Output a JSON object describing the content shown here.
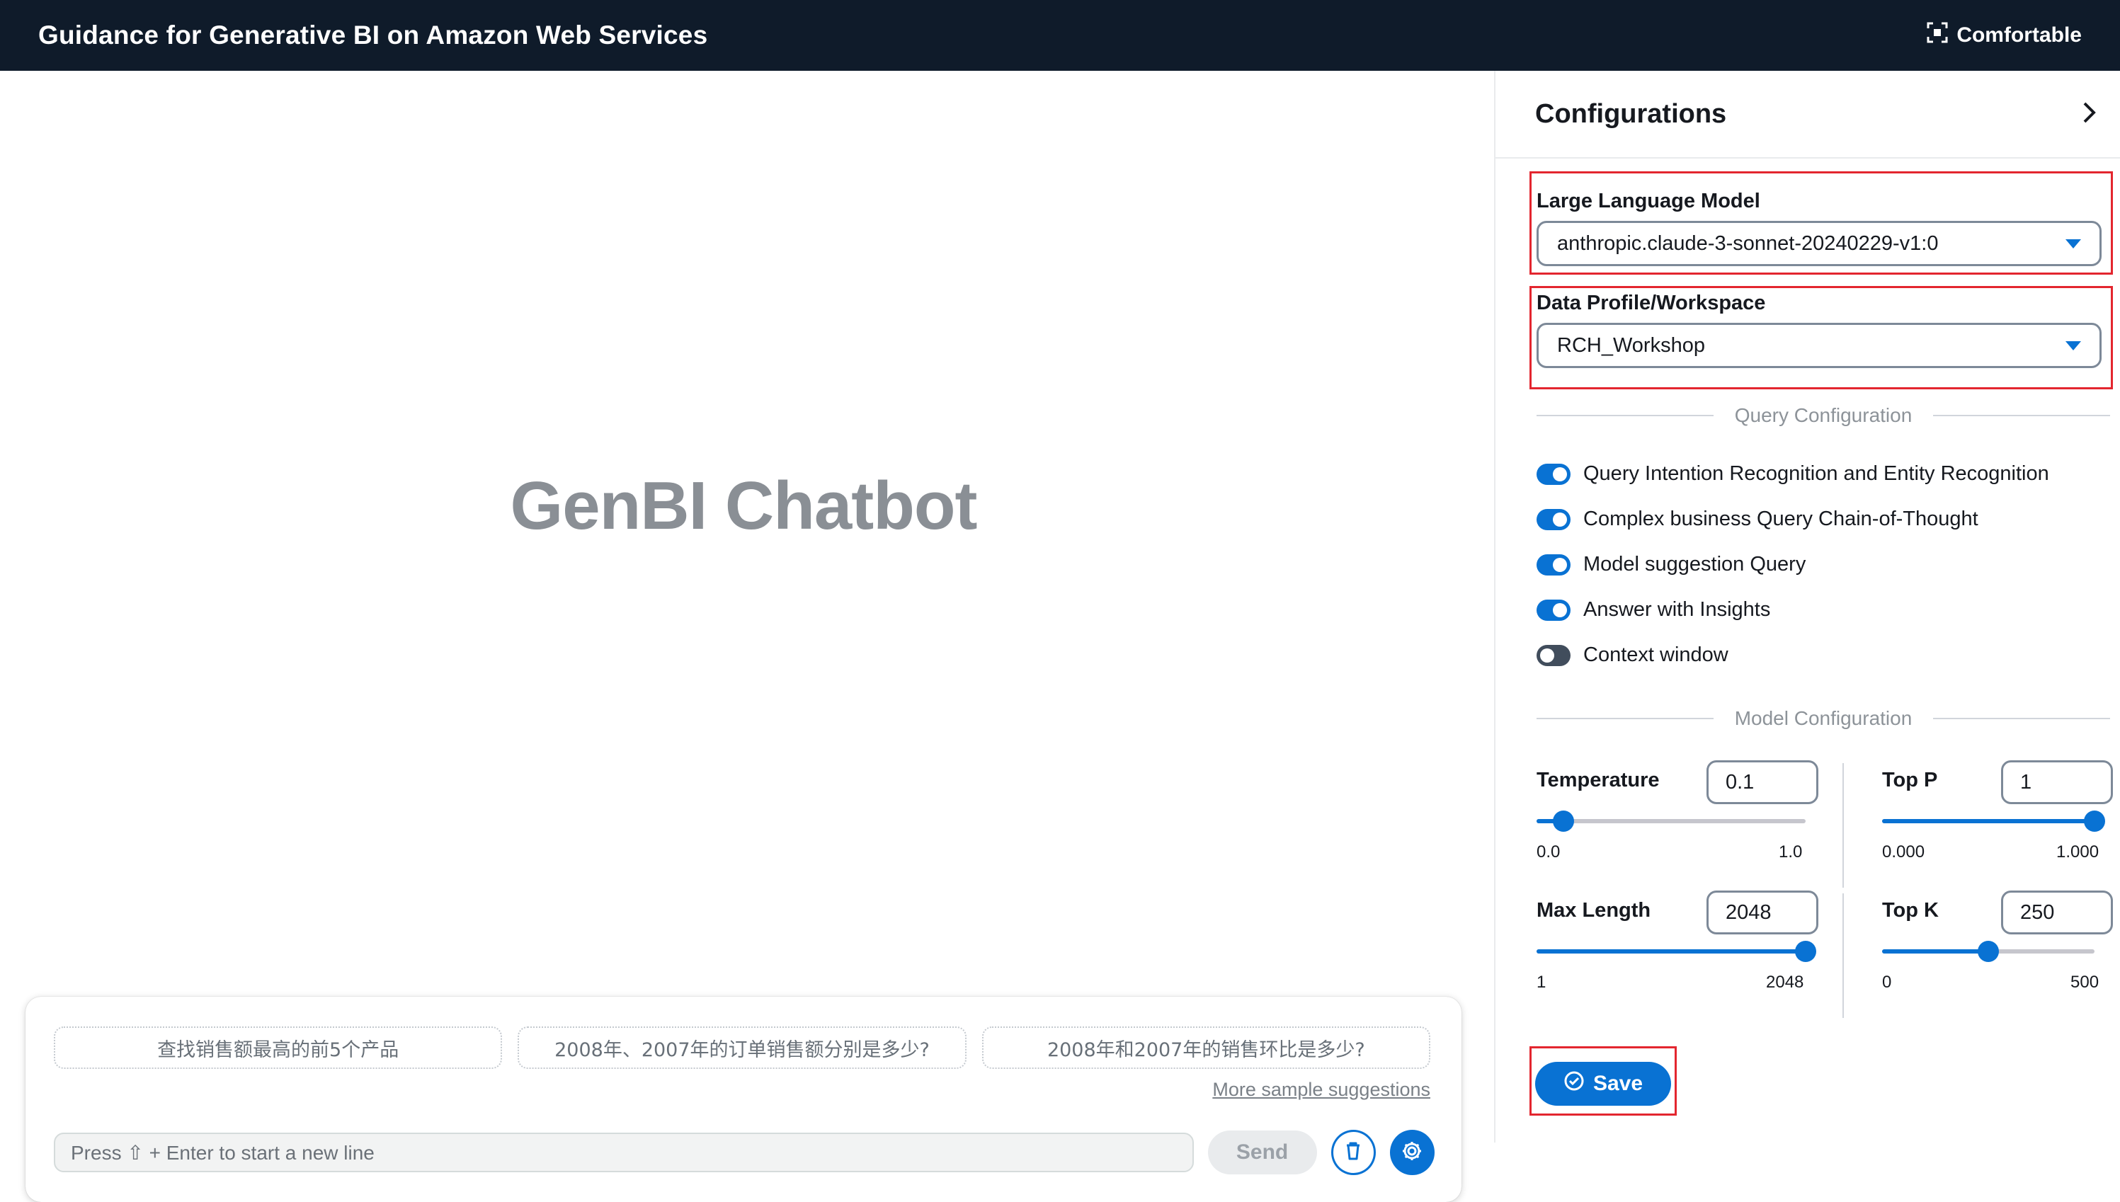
{
  "header": {
    "title": "Guidance for Generative BI on Amazon Web Services",
    "density_label": "Comfortable",
    "density_icon": "focus-frame-icon"
  },
  "main": {
    "hero_title": "GenBI Chatbot"
  },
  "chat": {
    "suggestions": [
      "查找销售额最高的前5个产品",
      "2008年、2007年的订单销售额分别是多少?",
      "2008年和2007年的销售环比是多少?"
    ],
    "more_suggestions": "More sample suggestions",
    "input_placeholder": "Press ⇧ + Enter to start a new line",
    "send_label": "Send",
    "clear_icon": "trash-icon",
    "settings_icon": "gear-icon"
  },
  "config": {
    "title": "Configurations",
    "llm": {
      "label": "Large Language Model",
      "value": "anthropic.claude-3-sonnet-20240229-v1:0"
    },
    "profile": {
      "label": "Data Profile/Workspace",
      "value": "RCH_Workshop"
    },
    "query_section": "Query Configuration",
    "toggles": [
      {
        "label": "Query Intention Recognition and Entity Recognition",
        "on": true
      },
      {
        "label": "Complex business Query Chain-of-Thought",
        "on": true
      },
      {
        "label": "Model suggestion Query",
        "on": true
      },
      {
        "label": "Answer with Insights",
        "on": true
      },
      {
        "label": "Context window",
        "on": false
      }
    ],
    "model_section": "Model Configuration",
    "temperature": {
      "label": "Temperature",
      "value": "0.1",
      "min": "0.0",
      "max": "1.0",
      "fraction": 0.1
    },
    "top_p": {
      "label": "Top P",
      "value": "1",
      "min": "0.000",
      "max": "1.000",
      "fraction": 1.0
    },
    "max_length": {
      "label": "Max Length",
      "value": "2048",
      "min": "1",
      "max": "2048",
      "fraction": 1.0
    },
    "top_k": {
      "label": "Top K",
      "value": "250",
      "min": "0",
      "max": "500",
      "fraction": 0.5
    },
    "save_label": "Save"
  },
  "colors": {
    "header_bg": "#0f1b2a",
    "accent": "#0972d3",
    "highlight": "#e3262f"
  }
}
